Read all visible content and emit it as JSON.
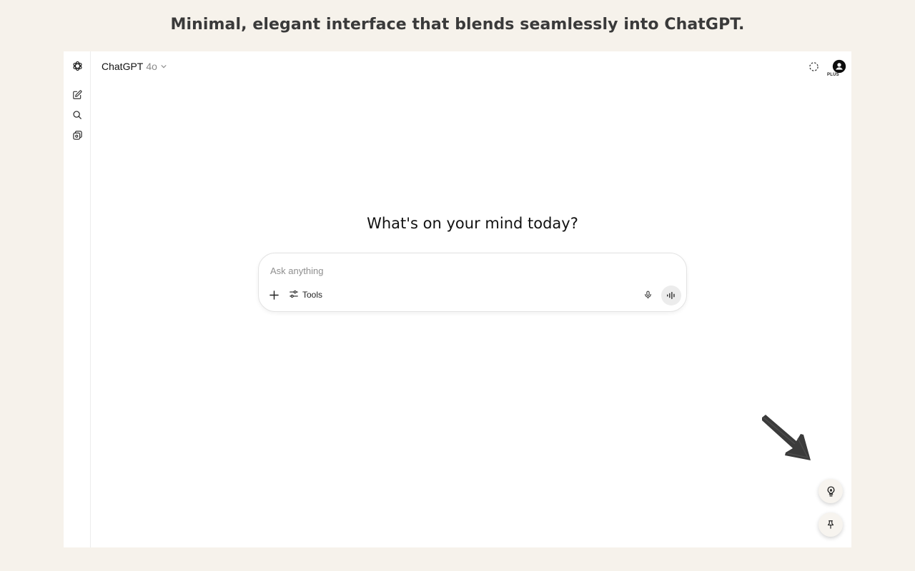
{
  "headline": "Minimal, elegant interface that blends seamlessly into ChatGPT.",
  "header": {
    "model_name": "ChatGPT",
    "model_version": "4o",
    "plan_badge": "PLUS"
  },
  "main": {
    "greeting": "What's on your mind today?"
  },
  "composer": {
    "placeholder": "Ask anything",
    "tools_label": "Tools"
  },
  "icons": {
    "logo": "openai-logo-icon",
    "new_chat": "new-chat-icon",
    "search": "search-icon",
    "library": "library-icon",
    "temporary_chat": "temporary-chat-icon",
    "avatar": "user-avatar-icon",
    "add": "plus-icon",
    "tools": "sliders-icon",
    "mic": "microphone-icon",
    "voice": "voice-mode-icon",
    "lightbulb": "lightbulb-icon",
    "pin": "pin-icon",
    "arrow": "hand-drawn-arrow-icon"
  },
  "colors": {
    "page_background": "#f6f2eb",
    "app_background": "#ffffff",
    "headline": "#3a3a3a",
    "voice_button": "#ececec",
    "floating_button": "#f7f4ef"
  }
}
